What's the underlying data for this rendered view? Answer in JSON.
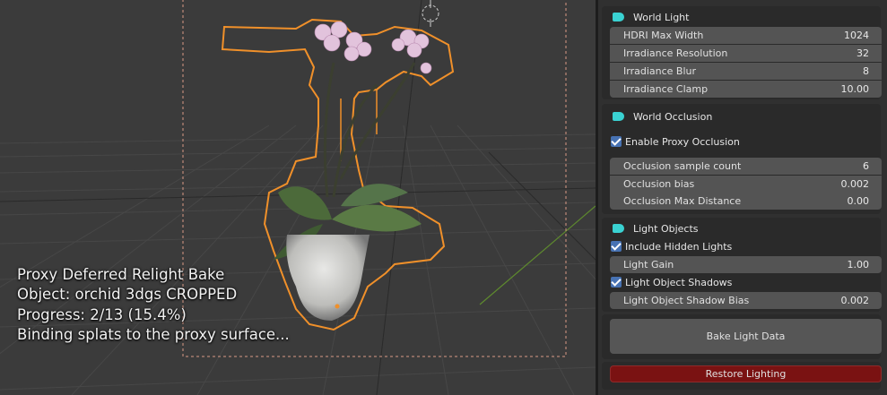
{
  "viewport": {
    "overlay": {
      "line1": "Proxy Deferred Relight Bake",
      "line2": "Object: orchid 3dgs CROPPED",
      "line3": "Progress: 2/13 (15.4%)",
      "line4": "Binding splats to the proxy surface..."
    }
  },
  "panel": {
    "world_light": {
      "title": "World Light",
      "fields": [
        {
          "label": "HDRI Max Width",
          "value": "1024"
        },
        {
          "label": "Irradiance Resolution",
          "value": "32"
        },
        {
          "label": "Irradiance Blur",
          "value": "8"
        },
        {
          "label": "Irradiance Clamp",
          "value": "10.00"
        }
      ]
    },
    "world_occlusion": {
      "title": "World Occlusion",
      "enable_label": "Enable Proxy Occlusion",
      "enable_checked": true,
      "fields": [
        {
          "label": "Occlusion sample count",
          "value": "6"
        },
        {
          "label": "Occlusion bias",
          "value": "0.002"
        },
        {
          "label": "Occlusion Max Distance",
          "value": "0.00"
        }
      ]
    },
    "light_objects": {
      "title": "Light Objects",
      "include_hidden_label": "Include Hidden Lights",
      "include_hidden_checked": true,
      "light_gain": {
        "label": "Light Gain",
        "value": "1.00"
      },
      "shadows_label": "Light Object Shadows",
      "shadows_checked": true,
      "shadow_bias": {
        "label": "Light Object Shadow Bias",
        "value": "0.002"
      }
    },
    "bake_button": "Bake Light Data",
    "restore_button": "Restore Lighting"
  },
  "colors": {
    "accent_tag": "#3ad2d2",
    "checkbox": "#4772b3",
    "restore_button": "#7a1212",
    "selection_outline": "#f0902a"
  }
}
